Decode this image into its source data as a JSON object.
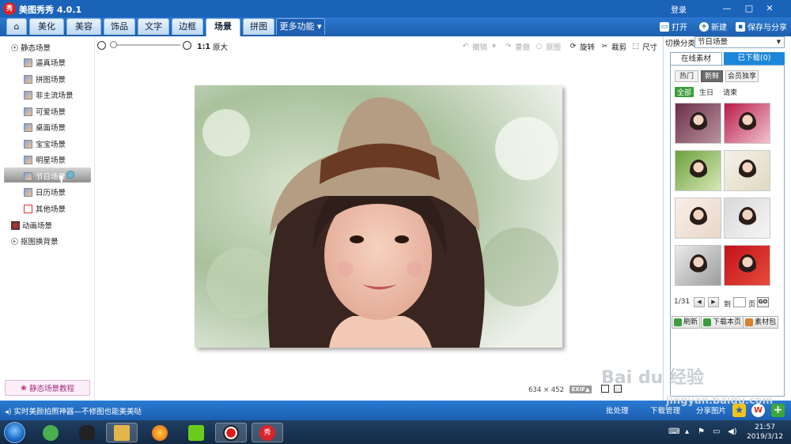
{
  "app": {
    "icon_text": "秀",
    "title": "美图秀秀 4.0.1",
    "login_label": "登录",
    "window_controls": [
      "—",
      "□",
      "✕"
    ]
  },
  "top_tabs": [
    {
      "label": "⌂",
      "active": false
    },
    {
      "label": "美化",
      "active": false
    },
    {
      "label": "美容",
      "active": false
    },
    {
      "label": "饰品",
      "active": false
    },
    {
      "label": "文字",
      "active": false
    },
    {
      "label": "边框",
      "active": false
    },
    {
      "label": "场景",
      "active": true
    },
    {
      "label": "拼图",
      "active": false
    },
    {
      "label": "更多功能 ▾",
      "active": false
    }
  ],
  "top_actions": {
    "open": "打开",
    "new": "新建",
    "save_share": "保存与分享"
  },
  "left_tree": {
    "static": "静态场景",
    "items": [
      "逼真场景",
      "拼图场景",
      "非主流场景",
      "可爱场景",
      "桌面场景",
      "宝宝场景",
      "明星场景",
      "节日场景",
      "日历场景",
      "其他场景"
    ],
    "animated": "动画场景",
    "cutout": "抠图换背景"
  },
  "tutorial_label": "静态场景教程",
  "toolbar": {
    "ratio_label": "1:1",
    "original_label": "原大",
    "undo": "撤销",
    "redo": "重做",
    "original_image": "原图",
    "rotate": "旋转",
    "crop": "裁剪",
    "resize": "尺寸"
  },
  "image_info": {
    "width": "634",
    "times": "×",
    "height": "452",
    "exif": "EXIF▲"
  },
  "right_panel": {
    "category_label": "切换分类",
    "category_value": "节日场景",
    "tabs": {
      "online": "在线素材",
      "downloaded": "已下载(0)"
    },
    "segments": [
      {
        "label": "热门",
        "on": false
      },
      {
        "label": "新鲜",
        "on": true
      },
      {
        "label": "会员独享",
        "on": false
      }
    ],
    "filters": [
      {
        "label": "全部",
        "on": true
      },
      {
        "label": "生日",
        "on": false
      },
      {
        "label": "请柬",
        "on": false
      }
    ],
    "pager": {
      "page": "1/31",
      "goto": "到",
      "page_unit": "页",
      "go": "GO"
    },
    "actions": {
      "refresh": "刷新",
      "download_page": "下载本页",
      "material_pack": "素材包"
    }
  },
  "statusbar": {
    "message": "实时美颜拍照神器—不修图也能美美哒",
    "batch": "批处理",
    "download_mgr": "下载管理",
    "share_img": "分享图片"
  },
  "taskbar": {
    "time": "21:57",
    "date": "2019/3/12"
  },
  "watermark": {
    "main": "Bai du 经验",
    "sub": "jingyan.baidu.com"
  },
  "colors": {
    "titlebar": "#1a63b8",
    "accent_blue": "#1c86d9",
    "active_green": "#3a9e3a",
    "tutorial_pink": "#a2307e"
  }
}
